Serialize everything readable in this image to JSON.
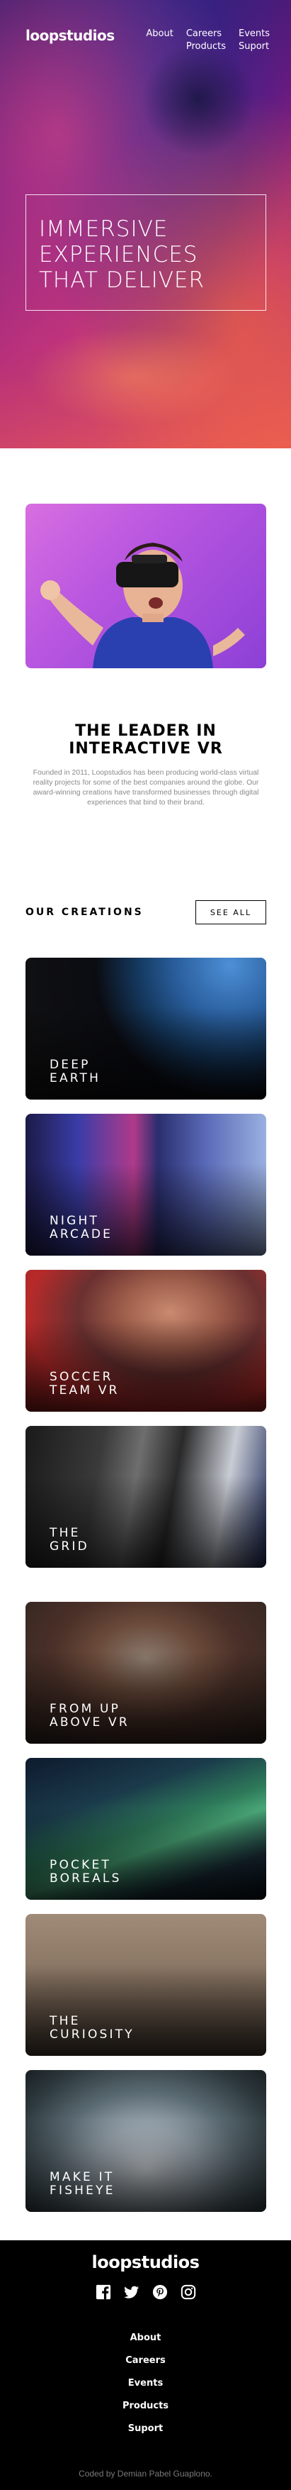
{
  "brand": {
    "logo": "loopstudios"
  },
  "nav": {
    "row1": [
      "About",
      "Careers",
      "Events"
    ],
    "row2": [
      "Products",
      "Suport"
    ]
  },
  "hero": {
    "title": "IMMERSIVE\nEXPERIENCES\nTHAT DELIVER"
  },
  "leader": {
    "title": "THE LEADER IN\nINTERACTIVE VR",
    "text": "Founded in 2011, Loopstudios has been producing world-class virtual reality projects for some of the best companies around the globe. Our award-winning creations have transformed businesses through digital experiences that bind to their brand."
  },
  "creations": {
    "title": "OUR CREATIONS",
    "see_all": "SEE ALL",
    "items": [
      {
        "label": "DEEP\nEARTH"
      },
      {
        "label": "NIGHT\nARCADE"
      },
      {
        "label": "SOCCER\nTEAM VR"
      },
      {
        "label": "THE\nGRID"
      },
      {
        "label": "FROM UP\nABOVE VR"
      },
      {
        "label": "POCKET\nBOREALS"
      },
      {
        "label": "THE\nCURIOSITY"
      },
      {
        "label": "MAKE IT\nFISHEYE"
      }
    ]
  },
  "footer": {
    "logo": "loopstudios",
    "socials": [
      "facebook-icon",
      "twitter-icon",
      "pinterest-icon",
      "instagram-icon"
    ],
    "links": [
      "About",
      "Careers",
      "Events",
      "Products",
      "Suport"
    ],
    "credit": "Coded by Demian Pabel Guaplono."
  }
}
